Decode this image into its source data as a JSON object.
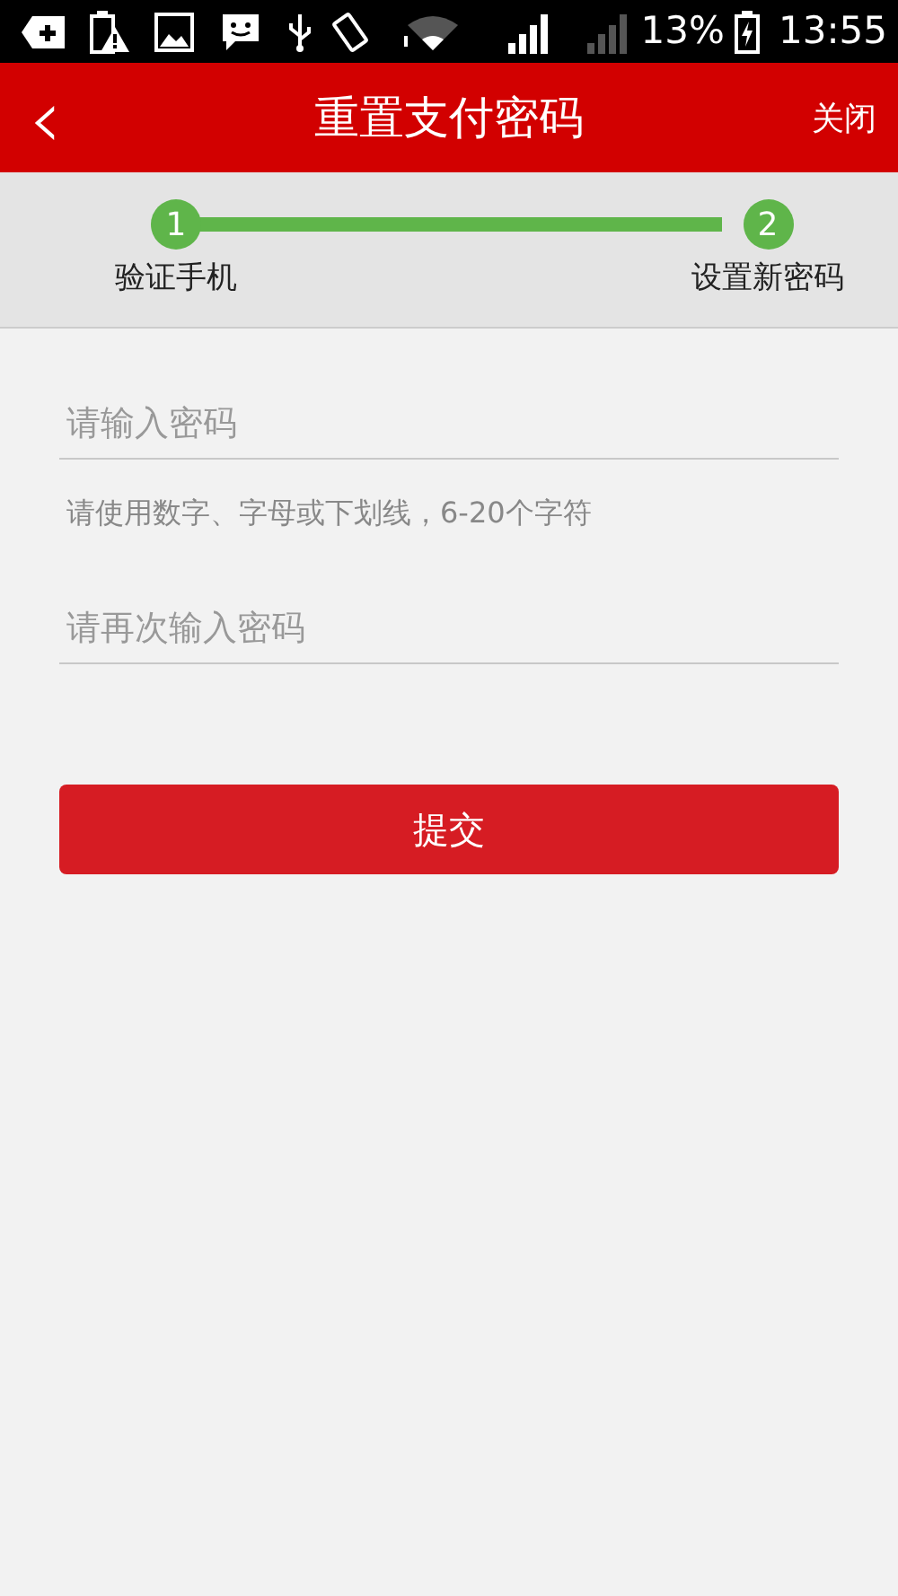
{
  "status_bar": {
    "battery": "13%",
    "time": "13:55"
  },
  "header": {
    "back": "‹",
    "title": "重置支付密码",
    "close": "关闭"
  },
  "steps": [
    {
      "number": "1",
      "label": "验证手机",
      "done": true
    },
    {
      "number": "2",
      "label": "设置新密码",
      "done": true
    }
  ],
  "form": {
    "fields": [
      {
        "placeholder": "请输入密码"
      },
      {
        "placeholder": "请再次输入密码"
      }
    ],
    "hint": "请使用数字、字母或下划线，6-20个字符",
    "submit": "提交"
  }
}
